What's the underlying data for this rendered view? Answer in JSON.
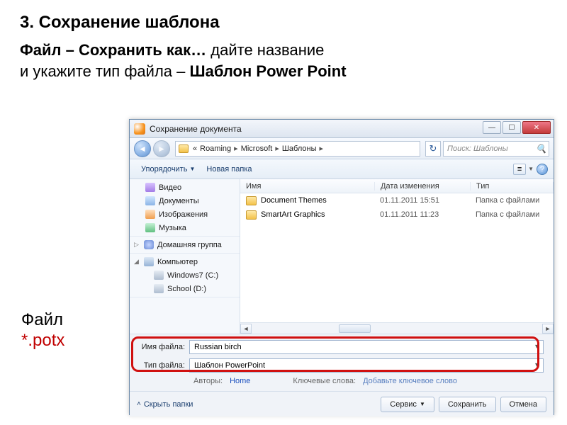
{
  "slide": {
    "heading": "3. Сохранение шаблона",
    "line1_bold": "Файл – Сохранить как…",
    "line1_tail": " дайте название",
    "line2_head": "и укажите тип файла – ",
    "line2_bold": "Шаблон Power Point",
    "file_word": "Файл",
    "file_ext": "*.potx"
  },
  "dialog": {
    "title": "Сохранение документа",
    "breadcrumb": {
      "prefix": "«",
      "parts": [
        "Roaming",
        "Microsoft",
        "Шаблоны"
      ]
    },
    "search_placeholder": "Поиск: Шаблоны",
    "toolbar": {
      "organize": "Упорядочить",
      "new_folder": "Новая папка"
    },
    "sidebar": {
      "items": [
        {
          "label": "Видео",
          "icon": "ico-video"
        },
        {
          "label": "Документы",
          "icon": "ico-doc"
        },
        {
          "label": "Изображения",
          "icon": "ico-pic"
        },
        {
          "label": "Музыка",
          "icon": "ico-music"
        }
      ],
      "homegroup": "Домашняя группа",
      "computer": "Компьютер",
      "drives": [
        {
          "label": "Windows7 (C:)"
        },
        {
          "label": "School (D:)"
        }
      ]
    },
    "list": {
      "columns": {
        "name": "Имя",
        "date": "Дата изменения",
        "type": "Тип"
      },
      "rows": [
        {
          "name": "Document Themes",
          "date": "01.11.2011 15:51",
          "type": "Папка с файлами"
        },
        {
          "name": "SmartArt Graphics",
          "date": "01.11.2011 11:23",
          "type": "Папка с файлами"
        }
      ]
    },
    "filename": {
      "label": "Имя файла:",
      "value": "Russian birch"
    },
    "filetype": {
      "label": "Тип файла:",
      "value": "Шаблон PowerPoint"
    },
    "meta": {
      "authors_label": "Авторы:",
      "authors_value": "Home",
      "keywords_label": "Ключевые слова:",
      "keywords_value": "Добавьте ключевое слово"
    },
    "bottom": {
      "hide_folders": "Скрыть папки",
      "tools": "Сервис",
      "save": "Сохранить",
      "cancel": "Отмена"
    }
  }
}
